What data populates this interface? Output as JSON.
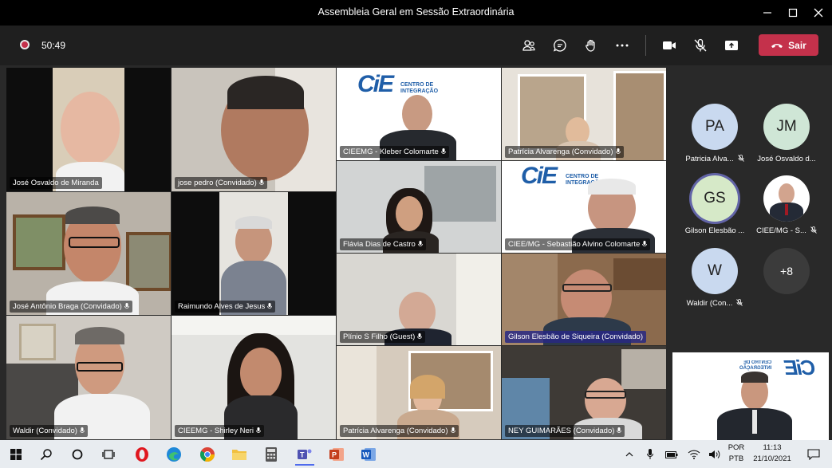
{
  "window": {
    "title": "Assembleia Geral em Sessão Extraordinária"
  },
  "toolbar": {
    "timer": "50:49",
    "leave_label": "Sair"
  },
  "tiles": [
    {
      "name": "José Osvaldo de Miranda"
    },
    {
      "name": "jose pedro (Convidado)"
    },
    {
      "name": "CIEEMG - Kleber Colomarte"
    },
    {
      "name": "Patrícia Alvarenga (Convidado)"
    },
    {
      "name": "Flávia Dias de Castro"
    },
    {
      "name": "CIEE/MG - Sebastião Alvino Colomarte"
    },
    {
      "name": "José Antônio Braga (Convidado)"
    },
    {
      "name": "Raimundo Alves de Jesus"
    },
    {
      "name": "Plínio S Filho (Guest)"
    },
    {
      "name": "Gilson Elesbão de Siqueira (Convidado)"
    },
    {
      "name": "Waldir (Convidado)"
    },
    {
      "name": "CIEEMG - Shirley Neri"
    },
    {
      "name": "Patrícia Alvarenga (Convidado)"
    },
    {
      "name": "NEY GUIMARÃES (Convidado)"
    }
  ],
  "logo": {
    "mark": "CiE",
    "line1": "CENTRO DE",
    "line2": "INTEGRAÇÃO",
    "line3": "EMPRESA-ESCOLA",
    "line4": "MINAS GERAIS"
  },
  "roster": [
    {
      "initials": "PA",
      "name": "Patricia Alva...",
      "color": "#c9d9ef"
    },
    {
      "initials": "JM",
      "name": "José Osvaldo d...",
      "color": "#cfe6d6"
    },
    {
      "initials": "GS",
      "name": "Gilson Elesbão ...",
      "color": "#d6e9c8"
    },
    {
      "initials": "",
      "name": "CIEE/MG - S...",
      "color": "#ffffff"
    },
    {
      "initials": "W",
      "name": "Waldir (Con...",
      "color": "#c9d9ef"
    },
    {
      "initials": "+8",
      "name": "",
      "color": "#3b3b3b"
    }
  ],
  "taskbar": {
    "lang1": "POR",
    "lang2": "PTB",
    "time": "11:13",
    "date": "21/10/2021"
  },
  "colors": {
    "accent_red": "#c4314b",
    "toolbar": "#1f1f1f",
    "stage": "#292929"
  }
}
